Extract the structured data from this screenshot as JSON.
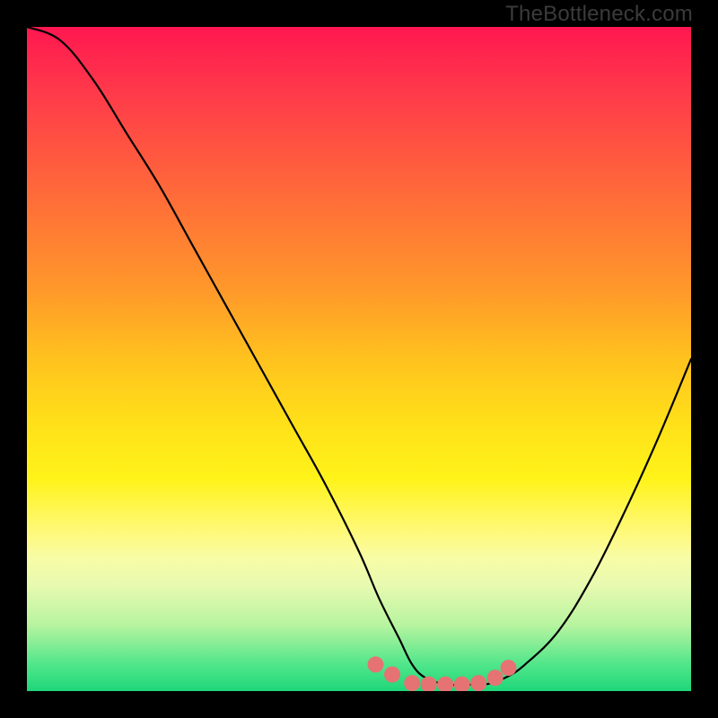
{
  "watermark": "TheBottleneck.com",
  "colors": {
    "curve_stroke": "#000000",
    "marker_fill": "#e57373",
    "background_black": "#000000"
  },
  "chart_data": {
    "type": "line",
    "title": "",
    "xlabel": "",
    "ylabel": "",
    "xlim": [
      0,
      100
    ],
    "ylim": [
      0,
      100
    ],
    "grid": false,
    "legend": false,
    "series": [
      {
        "name": "bottleneck-curve",
        "x": [
          0,
          5,
          10,
          15,
          20,
          25,
          30,
          35,
          40,
          45,
          50,
          53,
          56,
          58,
          60,
          63,
          66,
          69,
          72,
          75,
          80,
          85,
          90,
          95,
          100
        ],
        "values": [
          100,
          98,
          92,
          84,
          76,
          67,
          58,
          49,
          40,
          31,
          21,
          14,
          8,
          4,
          2,
          1,
          1,
          1,
          2,
          4,
          9,
          17,
          27,
          38,
          50
        ]
      }
    ],
    "markers": [
      {
        "x": 52.5,
        "y": 4.0
      },
      {
        "x": 55.0,
        "y": 2.5
      },
      {
        "x": 58.0,
        "y": 1.2
      },
      {
        "x": 60.5,
        "y": 1.0
      },
      {
        "x": 63.0,
        "y": 1.0
      },
      {
        "x": 65.5,
        "y": 1.0
      },
      {
        "x": 68.0,
        "y": 1.2
      },
      {
        "x": 70.5,
        "y": 2.0
      },
      {
        "x": 72.5,
        "y": 3.5
      }
    ],
    "marker_radius": 9,
    "annotations": []
  }
}
